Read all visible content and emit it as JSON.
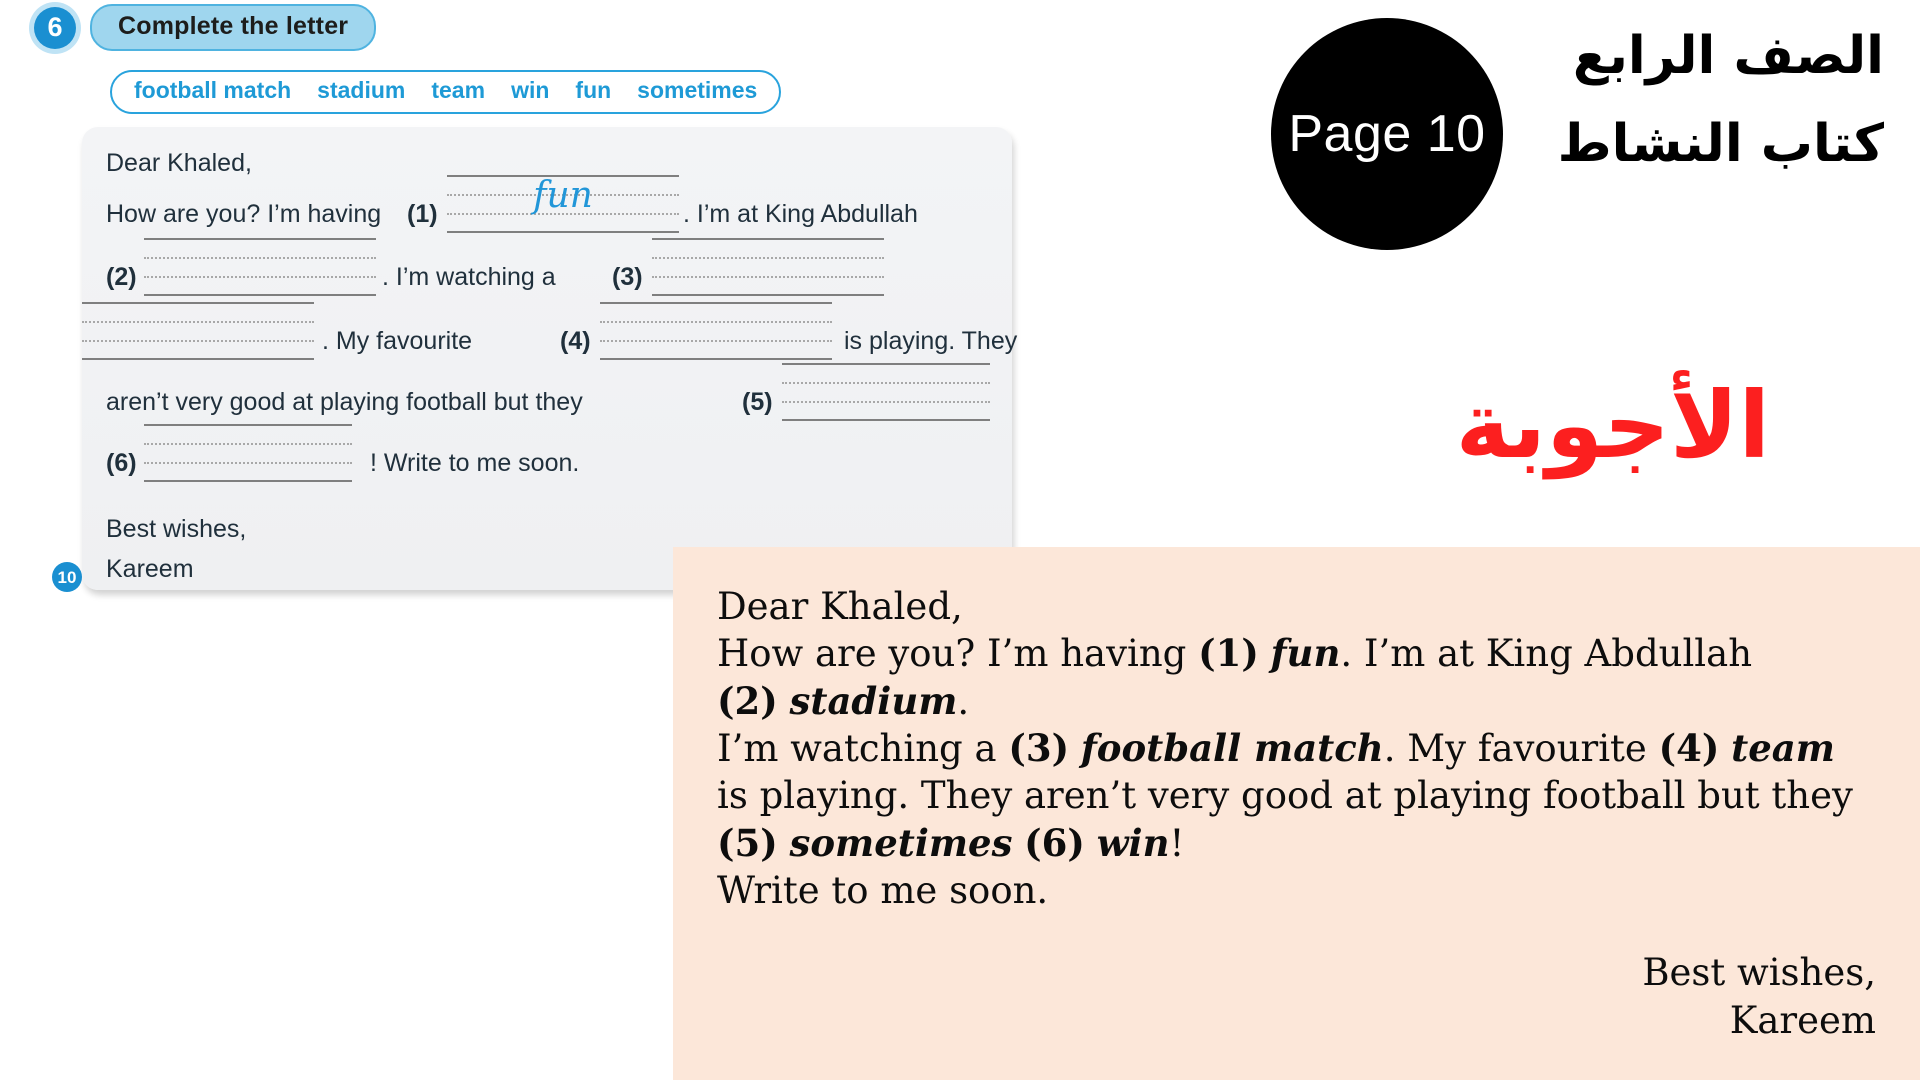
{
  "exercise": {
    "number": "6",
    "title": "Complete the letter",
    "page_marker": "10",
    "word_bank": [
      "football match",
      "stadium",
      "team",
      "win",
      "fun",
      "sometimes"
    ],
    "letter": {
      "salutation": "Dear Khaled,",
      "seg_1": "How are you? I’m having",
      "num_1": "(1)",
      "answer_1": "fun",
      "seg_2": ". I’m at King Abdullah",
      "num_2": "(2)",
      "seg_3": ". I’m watching a",
      "num_3": "(3)",
      "seg_4": ". My favourite",
      "num_4": "(4)",
      "seg_5": "is playing. They",
      "seg_6": "aren’t very good at playing football but they",
      "num_5": "(5)",
      "num_6": "(6)",
      "seg_7": "! Write to me soon.",
      "closing_1": "Best wishes,",
      "closing_2": "Kareem"
    }
  },
  "badge": {
    "label": "Page 10"
  },
  "arabic": {
    "grade": "الصف الرابع",
    "book": "كتاب النشاط",
    "answers_title": "الأجوبة"
  },
  "answer_key": {
    "line_1": "Dear Khaled,",
    "line_2_a": "How are you? I’m having ",
    "line_2_n": "(1)",
    "line_2_w": "fun",
    "line_2_b": ". I’m at King Abdullah",
    "line_3_n": "(2)",
    "line_3_w": "stadium",
    "line_3_b": ".",
    "line_4_a": "I’m watching a ",
    "line_4_n": "(3)",
    "line_4_w": "football match",
    "line_4_b": ". My favourite ",
    "line_4_n2": "(4)",
    "line_4_w2": "team",
    "line_5": "is playing. They aren’t very good at playing football but they ",
    "line_5_n": "(5)",
    "line_5_w": "sometimes",
    "line_5_n2": "(6)",
    "line_5_w2": "win",
    "line_5_b": "!",
    "line_6": "Write to me soon.",
    "closing_1": "Best wishes,",
    "closing_2": "Kareem"
  },
  "colors": {
    "accent_blue": "#1e9ad6",
    "pill_blue": "#9fd6ee",
    "answer_red": "#fc1f1f",
    "panel_peach": "#fce7d9",
    "card_grey": "#f1f2f4",
    "handwriting_blue": "#2196d8"
  }
}
